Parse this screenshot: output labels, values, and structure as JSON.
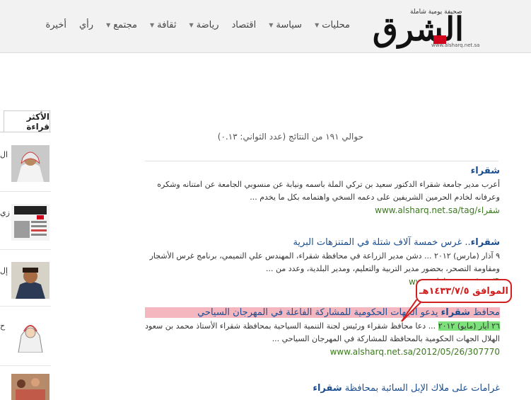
{
  "header": {
    "logo_word": "الشرق",
    "logo_tagline": "صحيفة يومية شاملة",
    "logo_url": "www.alsharq.net.sa",
    "nav": [
      {
        "label": "محليات",
        "has_menu": true
      },
      {
        "label": "سياسة",
        "has_menu": true
      },
      {
        "label": "اقتصاد",
        "has_menu": false
      },
      {
        "label": "رياضة",
        "has_menu": true
      },
      {
        "label": "ثقافة",
        "has_menu": true
      },
      {
        "label": "مجتمع",
        "has_menu": true
      },
      {
        "label": "رأي",
        "has_menu": false
      },
      {
        "label": "أخيرة",
        "has_menu": false
      }
    ]
  },
  "sidebar": {
    "tab_label": "الأكثر قراءة",
    "items": [
      {
        "text": "ال"
      },
      {
        "text": "زي"
      },
      {
        "text": "إل"
      },
      {
        "text": "ح"
      },
      {
        "text": ""
      }
    ]
  },
  "search": {
    "results_summary": "حوالي ١٩١ من النتائج (عدد الثواني: ٠.١٣)",
    "results": [
      {
        "title_bold": "شقراء",
        "title_rest": "",
        "snippet_1": "أعرب مدير جامعة شقراء الدكتور سعيد بن تركي الملة باسمه ونيابة عن منسوبي الجامعة عن امتنانه وشكره",
        "snippet_2": "وعرفانه لخادم الحرمين الشريفين على دعمه السخي واهتمامه بكل ما يخدم ...",
        "url": "www.alsharq.net.sa/tag/شقراء"
      },
      {
        "title_bold": "شقراء",
        "title_rest": ".. غرس خمسة آلاف شتلة في المتنزهات البرية",
        "snippet_1": "٩ آذار (مارس) ٢٠١٢ ... دشن مدير الزراعة في محافظة شقراء، المهندس علي التميمي، برنامج غرس الأشجار",
        "snippet_2": "ومقاومة التصحر، بحضور مدير التربية والتعليم، ومدير البلدية، وعدد من ...",
        "url": "www.alsharq.net.sa/2"
      },
      {
        "title_pre": "محافظ ",
        "title_bold": "شقراء",
        "title_rest": " يدعو الجهات الحكومية للمشاركة الفاعلة في المهرجان السياحي",
        "date": "٢٦ أيار (مايو) ٢٠١٢",
        "snippet_1": " ... دعا محافظ شقراء ورئيس لجنة التنمية السياحية بمحافظة شقراء الأستاذ محمد بن سعود",
        "snippet_2": "الهلال الجهات الحكومية بالمحافظة للمشاركة في المهرجان السياحي ...",
        "url": "www.alsharq.net.sa/2012/05/26/307770"
      },
      {
        "title_pre": "غرامات على ملاك الإبل السائبة بمحافظة ",
        "title_bold": "شقراء",
        "title_rest": ""
      }
    ]
  },
  "annotation": {
    "callout_text": "الموافق ١٤٣٣/٧/٥هـ"
  },
  "colors": {
    "link": "#1a4d8f",
    "url_green": "#3b7a1e",
    "highlight_red": "#f4b7c0",
    "highlight_green": "#7ee07a",
    "callout_red": "#d02020"
  }
}
